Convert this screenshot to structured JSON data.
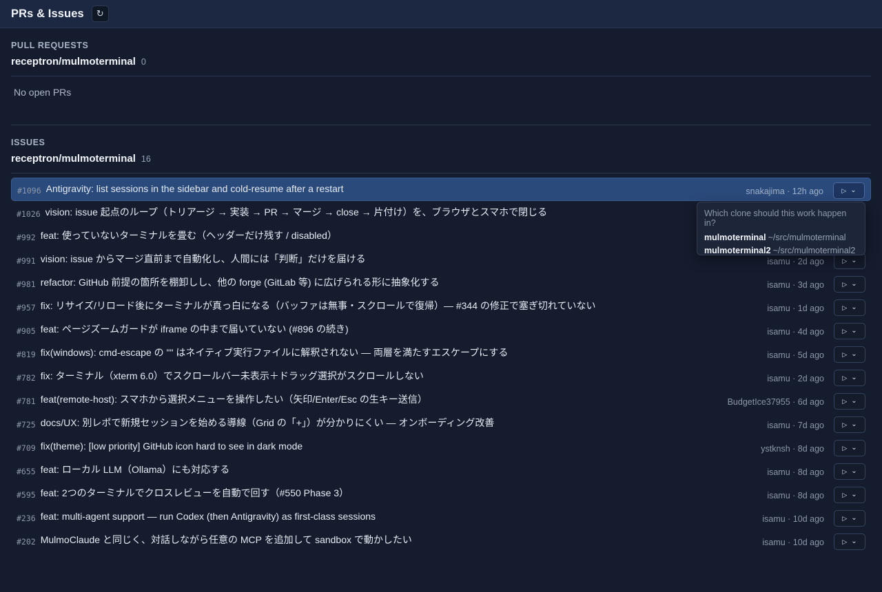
{
  "header": {
    "title": "PRs & Issues",
    "refresh_icon": "refresh-icon"
  },
  "pull_requests": {
    "label": "PULL REQUESTS",
    "repo": "receptron/mulmoterminal",
    "count": "0",
    "empty": "No open PRs"
  },
  "issues": {
    "label": "ISSUES",
    "repo": "receptron/mulmoterminal",
    "count": "16",
    "items": [
      {
        "num": "#1096",
        "title": "Antigravity: list sessions in the sidebar and cold-resume after a restart",
        "meta": "snakajima · 12h ago"
      },
      {
        "num": "#1026",
        "title": "vision: issue 起点のループ（トリアージ → 実装 → PR → マージ → close → 片付け）を、ブラウザとスマホで閉じる",
        "meta": ""
      },
      {
        "num": "#992",
        "title": "feat: 使っていないターミナルを畳む（ヘッダーだけ残す / disabled）",
        "meta": ""
      },
      {
        "num": "#991",
        "title": "vision: issue からマージ直前まで自動化し、人間には「判断」だけを届ける",
        "meta": "isamu · 2d ago"
      },
      {
        "num": "#981",
        "title": "refactor: GitHub 前提の箇所を棚卸しし、他の forge (GitLab 等) に広げられる形に抽象化する",
        "meta": "isamu · 3d ago"
      },
      {
        "num": "#957",
        "title": "fix: リサイズ/リロード後にターミナルが真っ白になる（バッファは無事・スクロールで復帰）— #344 の修正で塞ぎ切れていない",
        "meta": "isamu · 1d ago"
      },
      {
        "num": "#905",
        "title": "feat: ページズームガードが iframe の中まで届いていない (#896 の続き)",
        "meta": "isamu · 4d ago"
      },
      {
        "num": "#819",
        "title": "fix(windows): cmd-escape の \"\" はネイティブ実行ファイルに解釈されない — 両層を満たすエスケープにする",
        "meta": "isamu · 5d ago"
      },
      {
        "num": "#782",
        "title": "fix: ターミナル（xterm 6.0）でスクロールバー未表示＋ドラッグ選択がスクロールしない",
        "meta": "isamu · 2d ago"
      },
      {
        "num": "#781",
        "title": "feat(remote-host): スマホから選択メニューを操作したい（矢印/Enter/Esc の生キー送信）",
        "meta": "BudgetIce37955 · 6d ago"
      },
      {
        "num": "#725",
        "title": "docs/UX: 別レポで新規セッションを始める導線（Grid の「+」）が分かりにくい — オンボーディング改善",
        "meta": "isamu · 7d ago"
      },
      {
        "num": "#709",
        "title": "fix(theme): [low priority] GitHub icon hard to see in dark mode",
        "meta": "ystknsh · 8d ago"
      },
      {
        "num": "#655",
        "title": "feat: ローカル LLM（Ollama）にも対応する",
        "meta": "isamu · 8d ago"
      },
      {
        "num": "#595",
        "title": "feat: 2つのターミナルでクロスレビューを自動で回す（#550 Phase 3）",
        "meta": "isamu · 8d ago"
      },
      {
        "num": "#236",
        "title": "feat: multi-agent support — run Codex (then Antigravity) as first-class sessions",
        "meta": "isamu · 10d ago"
      },
      {
        "num": "#202",
        "title": "MulmoClaude と同じく、対話しながら任意の MCP を追加して sandbox で動かしたい",
        "meta": "isamu · 10d ago"
      }
    ]
  },
  "clone_dropdown": {
    "prompt": "Which clone should this work happen in?",
    "options": [
      {
        "name": "mulmoterminal",
        "path": "~/src/mulmoterminal"
      },
      {
        "name": "mulmoterminal2",
        "path": "~/src/mulmoterminal2"
      }
    ]
  },
  "icons": {
    "run": "play-icon",
    "menu": "chevron-down-icon"
  },
  "colors": {
    "background": "#151c2e",
    "header": "#1c2741",
    "selected_row": "#2b4a7c"
  }
}
